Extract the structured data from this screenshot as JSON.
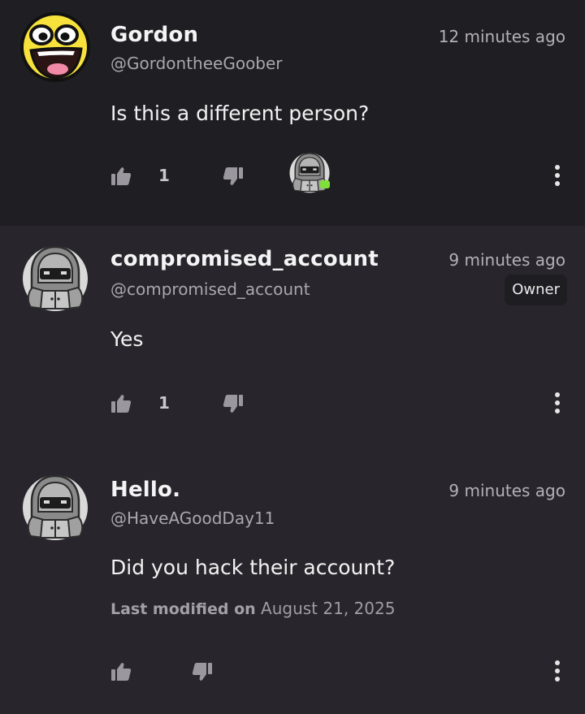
{
  "comments": [
    {
      "name": "Gordon",
      "handle": "@GordontheeGoober",
      "time": "12 minutes ago",
      "body": "Is this a different person?",
      "likes": "1",
      "avatar_icon": "awesome-face-icon"
    },
    {
      "name": "compromised_account",
      "handle": "@compromised_account",
      "time": "9 minutes ago",
      "badge": "Owner",
      "body": "Yes",
      "likes": "1",
      "avatar_icon": "hooded-figure-icon"
    },
    {
      "name": "Hello.",
      "handle": "@HaveAGoodDay11",
      "time": "9 minutes ago",
      "body": "Did you hack their account?",
      "modified_label": "Last modified on",
      "modified_date": "August 21, 2025",
      "avatar_icon": "hooded-figure-icon"
    }
  ],
  "colors": {
    "background": "#28262c",
    "highlighted_background": "#1f1e22",
    "online_status": "#7fe03a"
  }
}
